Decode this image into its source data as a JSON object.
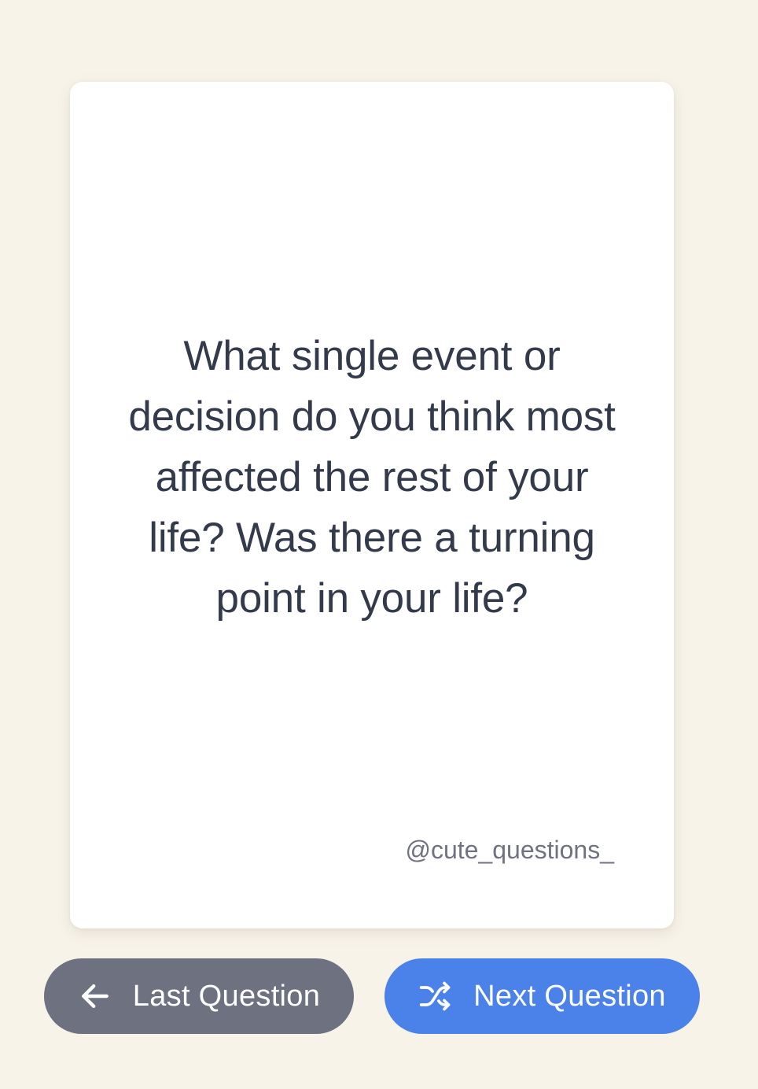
{
  "card": {
    "question": "What single event or decision do you think most affected the rest of your life? Was there a turning point in your life?",
    "handle": "@cute_questions_"
  },
  "buttons": {
    "last": {
      "label": "Last Question",
      "icon": "arrow-left-icon"
    },
    "next": {
      "label": "Next Question",
      "icon": "shuffle-icon"
    }
  },
  "colors": {
    "background": "#f7f3e9",
    "card": "#ffffff",
    "text": "#323a4b",
    "last_button": "#6e7180",
    "next_button": "#4a82ea"
  }
}
